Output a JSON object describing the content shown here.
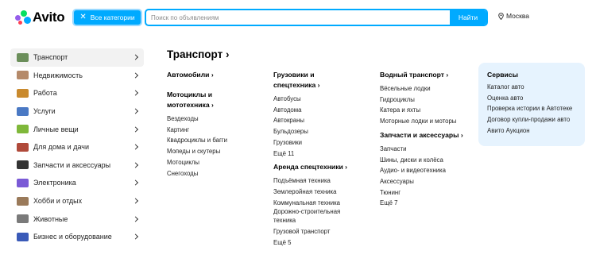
{
  "header": {
    "logo_text": "Avito",
    "categories_button": "Все категории",
    "search_placeholder": "Поиск по объявлениям",
    "find_button": "Найти",
    "location": "Москва"
  },
  "sidebar": {
    "items": [
      {
        "label": "Транспорт",
        "icon": "car-icon",
        "color": "#6b8e5a",
        "active": true
      },
      {
        "label": "Недвижимость",
        "icon": "building-icon",
        "color": "#b58a6a"
      },
      {
        "label": "Работа",
        "icon": "briefcase-icon",
        "color": "#c98a2e"
      },
      {
        "label": "Услуги",
        "icon": "tools-icon",
        "color": "#4a79c4"
      },
      {
        "label": "Личные вещи",
        "icon": "shirt-icon",
        "color": "#7fb83a"
      },
      {
        "label": "Для дома и дачи",
        "icon": "sofa-icon",
        "color": "#b04a3a"
      },
      {
        "label": "Запчасти и аксессуары",
        "icon": "tire-icon",
        "color": "#333333"
      },
      {
        "label": "Электроника",
        "icon": "laptop-icon",
        "color": "#7a5ad6"
      },
      {
        "label": "Хобби и отдых",
        "icon": "guitar-icon",
        "color": "#9a7a5a"
      },
      {
        "label": "Животные",
        "icon": "cat-icon",
        "color": "#7a7a7a"
      },
      {
        "label": "Бизнес и оборудование",
        "icon": "register-icon",
        "color": "#3a5ab8"
      }
    ]
  },
  "main": {
    "title": "Транспорт",
    "col1": {
      "auto": "Автомобили",
      "moto_header": [
        "Мотоциклы и",
        "мототехника"
      ],
      "moto_links": [
        "Вездеходы",
        "Картинг",
        "Квадроциклы и багги",
        "Мопеды и скутеры",
        "Мотоциклы",
        "Снегоходы"
      ]
    },
    "col2": {
      "trucks_header": [
        "Грузовики и",
        "спецтехника"
      ],
      "trucks_links": [
        "Автобусы",
        "Автодома",
        "Автокраны",
        "Бульдозеры",
        "Грузовики",
        "Ещё 11"
      ],
      "rent_header": "Аренда спецтехники",
      "rent_links": [
        "Подъёмная техника",
        "Землеройная техника",
        "Коммунальная техника",
        "Дорожно-строительная",
        "техника",
        "Грузовой транспорт",
        "Ещё 5"
      ]
    },
    "col3": {
      "water_header": "Водный транспорт",
      "water_links": [
        "Вёсельные лодки",
        "Гидроциклы",
        "Катера и яхты",
        "Моторные лодки и моторы"
      ],
      "parts_header": "Запчасти и аксессуары",
      "parts_links": [
        "Запчасти",
        "Шины, диски и колёса",
        "Аудио- и видеотехника",
        "Аксессуары",
        "Тюнинг",
        "Ещё 7"
      ]
    },
    "services": {
      "header": "Сервисы",
      "links": [
        "Каталог авто",
        "Оценка авто",
        "Проверка истории в Автотеке",
        "Договор купли-продажи авто",
        "Авито Аукцион"
      ]
    }
  },
  "colors": {
    "accent": "#00aaff",
    "services_bg": "#e6f3fe"
  }
}
